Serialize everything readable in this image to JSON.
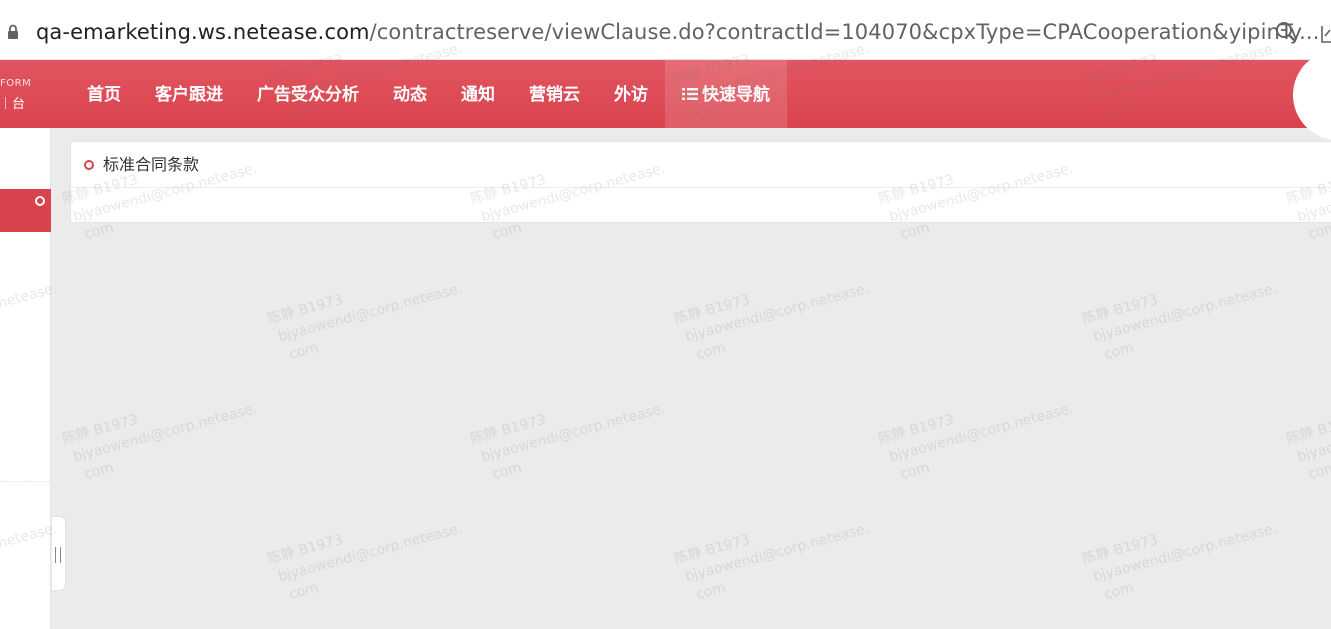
{
  "browser": {
    "url_host": "qa-emarketing.ws.netease.com",
    "url_path": "/contractreserve/viewClause.do?contractId=104070&cpxType=CPACooperation&yipinTy..."
  },
  "logo": {
    "form_text": "FORM",
    "tai_text": "台"
  },
  "nav": {
    "items": [
      {
        "label": "首页"
      },
      {
        "label": "客户跟进"
      },
      {
        "label": "广告受众分析"
      },
      {
        "label": "动态"
      },
      {
        "label": "通知"
      },
      {
        "label": "营销云"
      },
      {
        "label": "外访"
      },
      {
        "label": "快速导航",
        "icon": "list-icon",
        "active": true
      }
    ]
  },
  "panel": {
    "title": "标准合同条款"
  },
  "watermark": {
    "line1": "陈静 B1973",
    "line2": "bjyaowendi@corp.netease.",
    "line3": "com"
  },
  "colors": {
    "brand_red": "#d8434e",
    "background": "#ebebeb"
  }
}
